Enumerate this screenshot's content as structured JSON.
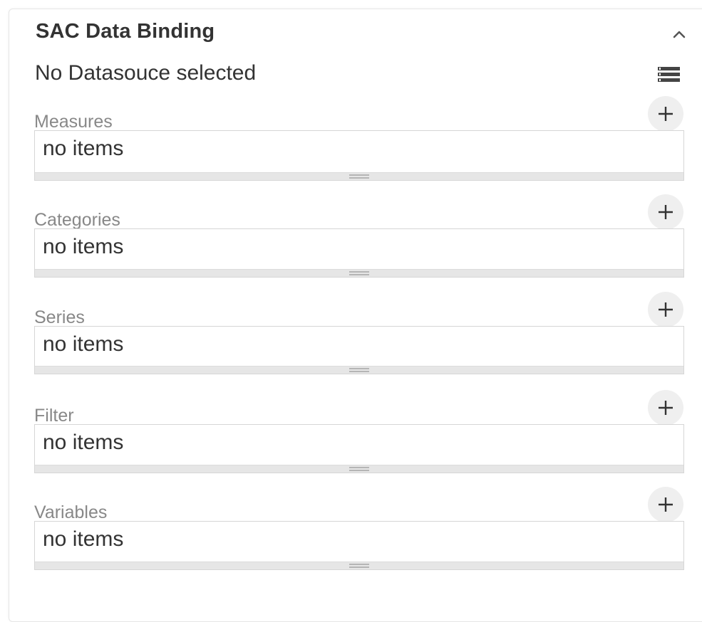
{
  "panel": {
    "title": "SAC Data Binding",
    "collapse_icon": "chevron-up-icon",
    "datasource_label": "No Datasouce selected",
    "datasource_icon": "list-icon"
  },
  "sections": [
    {
      "label": "Measures",
      "empty_text": "no items",
      "add_icon": "plus-icon"
    },
    {
      "label": "Categories",
      "empty_text": "no items",
      "add_icon": "plus-icon"
    },
    {
      "label": "Series",
      "empty_text": "no items",
      "add_icon": "plus-icon"
    },
    {
      "label": "Filter",
      "empty_text": "no items",
      "add_icon": "plus-icon"
    },
    {
      "label": "Variables",
      "empty_text": "no items",
      "add_icon": "plus-icon"
    }
  ],
  "colors": {
    "text": "#333333",
    "label": "#888888",
    "border": "#d6d6d6",
    "button_bg": "#efefef"
  }
}
